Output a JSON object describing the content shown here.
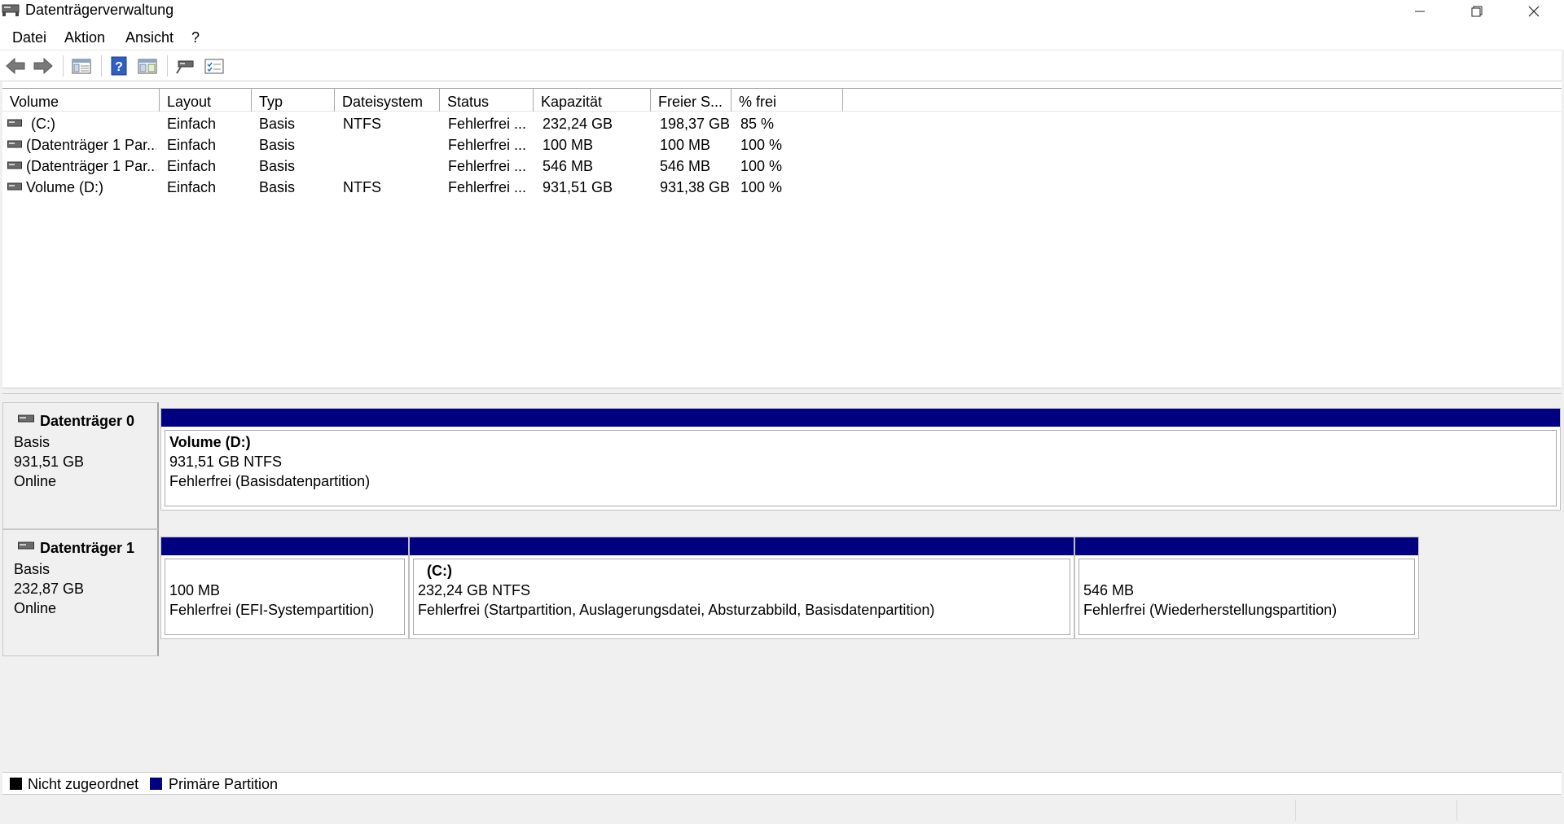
{
  "window": {
    "title": "Datenträgerverwaltung",
    "icons": {
      "app": "disk-management-icon",
      "minimize": "minimize-icon",
      "restore": "restore-icon",
      "close": "close-icon"
    }
  },
  "menu": {
    "items": [
      "Datei",
      "Aktion",
      "Ansicht",
      "?"
    ]
  },
  "toolbar": {
    "buttons": [
      "back-arrow-icon",
      "forward-arrow-icon",
      "console-tree-icon",
      "help-icon",
      "properties-icon",
      "connect-disk-icon",
      "checklist-icon"
    ]
  },
  "volume_list": {
    "columns": [
      "Volume",
      "Layout",
      "Typ",
      "Dateisystem",
      "Status",
      "Kapazität",
      "Freier S...",
      "% frei"
    ],
    "rows": [
      {
        "volume": "(C:)",
        "layout": "Einfach",
        "typ": "Basis",
        "fs": "NTFS",
        "status": "Fehlerfrei ...",
        "capacity": "232,24 GB",
        "free": "198,37 GB",
        "pct": "85 %"
      },
      {
        "volume": "(Datenträger 1 Par...",
        "layout": "Einfach",
        "typ": "Basis",
        "fs": "",
        "status": "Fehlerfrei ...",
        "capacity": "100 MB",
        "free": "100 MB",
        "pct": "100 %"
      },
      {
        "volume": "(Datenträger 1 Par...",
        "layout": "Einfach",
        "typ": "Basis",
        "fs": "",
        "status": "Fehlerfrei ...",
        "capacity": "546 MB",
        "free": "546 MB",
        "pct": "100 %"
      },
      {
        "volume": "Volume (D:)",
        "layout": "Einfach",
        "typ": "Basis",
        "fs": "NTFS",
        "status": "Fehlerfrei ...",
        "capacity": "931,51 GB",
        "free": "931,38 GB",
        "pct": "100 %"
      }
    ]
  },
  "disks": [
    {
      "name": "Datenträger 0",
      "type": "Basis",
      "size": "931,51 GB",
      "state": "Online",
      "partitions": [
        {
          "title": "Volume  (D:)",
          "line1": "931,51 GB NTFS",
          "line2": "Fehlerfrei (Basisdatenpartition)"
        }
      ]
    },
    {
      "name": "Datenträger 1",
      "type": "Basis",
      "size": "232,87 GB",
      "state": "Online",
      "partitions": [
        {
          "title": "",
          "line1": "100 MB",
          "line2": "Fehlerfrei (EFI-Systempartition)"
        },
        {
          "title": "(C:)",
          "line1": "232,24 GB NTFS",
          "line2": "Fehlerfrei (Startpartition, Auslagerungsdatei, Absturzabbild, Basisdatenpartition)"
        },
        {
          "title": "",
          "line1": "546 MB",
          "line2": "Fehlerfrei (Wiederherstellungspartition)"
        }
      ]
    }
  ],
  "legend": [
    {
      "label": "Nicht zugeordnet",
      "color": "#000000"
    },
    {
      "label": "Primäre Partition",
      "color": "#000080"
    }
  ],
  "colors": {
    "primary_partition": "#000080",
    "unallocated": "#000000"
  }
}
